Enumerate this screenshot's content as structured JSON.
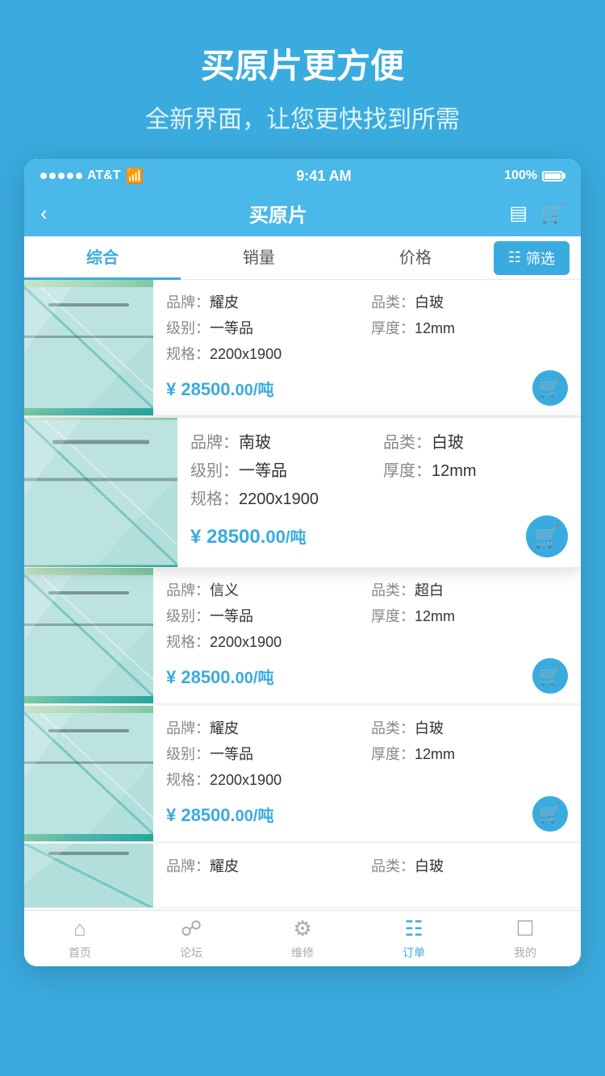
{
  "promo": {
    "title": "买原片更方便",
    "subtitle": "全新界面，让您更快找到所需"
  },
  "statusBar": {
    "carrier": "AT&T",
    "time": "9:41 AM",
    "battery": "100%"
  },
  "navBar": {
    "title": "买原片"
  },
  "sortBar": {
    "tabs": [
      "综合",
      "销量",
      "价格"
    ],
    "activeTab": "综合",
    "filterLabel": "筛选"
  },
  "products": [
    {
      "brand_label": "品牌：",
      "brand": "耀皮",
      "category_label": "品类：",
      "category": "白玻",
      "grade_label": "级别：",
      "grade": "一等品",
      "thickness_label": "厚度：",
      "thickness": "12mm",
      "spec_label": "规格：",
      "spec": "2200x1900",
      "price": "¥ 28500.",
      "price_decimal": "00",
      "price_unit": "/吨",
      "highlighted": false
    },
    {
      "brand_label": "品牌：",
      "brand": "南玻",
      "category_label": "品类：",
      "category": "白玻",
      "grade_label": "级别：",
      "grade": "一等品",
      "thickness_label": "厚度：",
      "thickness": "12mm",
      "spec_label": "规格：",
      "spec": "2200x1900",
      "price": "¥ 28500.",
      "price_decimal": "00",
      "price_unit": "/吨",
      "highlighted": true
    },
    {
      "brand_label": "品牌：",
      "brand": "信义",
      "category_label": "品类：",
      "category": "超白",
      "grade_label": "级别：",
      "grade": "一等品",
      "thickness_label": "厚度：",
      "thickness": "12mm",
      "spec_label": "规格：",
      "spec": "2200x1900",
      "price": "¥ 28500.",
      "price_decimal": "00",
      "price_unit": "/吨",
      "highlighted": false
    },
    {
      "brand_label": "品牌：",
      "brand": "耀皮",
      "category_label": "品类：",
      "category": "白玻",
      "grade_label": "级别：",
      "grade": "一等品",
      "thickness_label": "厚度：",
      "thickness": "12mm",
      "spec_label": "规格：",
      "spec": "2200x1900",
      "price": "¥ 28500.",
      "price_decimal": "00",
      "price_unit": "/吨",
      "highlighted": false
    },
    {
      "brand_label": "品牌：",
      "brand": "耀皮",
      "category_label": "品类：",
      "category": "白玻",
      "grade_label": "级别：",
      "grade": "",
      "thickness_label": "",
      "thickness": "",
      "spec_label": "",
      "spec": "",
      "price": "",
      "price_decimal": "",
      "price_unit": "",
      "highlighted": false,
      "partial": true
    }
  ],
  "tabBar": {
    "tabs": [
      {
        "id": "home",
        "label": "首页",
        "active": false
      },
      {
        "id": "forum",
        "label": "论坛",
        "active": false
      },
      {
        "id": "repair",
        "label": "维修",
        "active": false
      },
      {
        "id": "orders",
        "label": "订单",
        "active": true
      },
      {
        "id": "mine",
        "label": "我的",
        "active": false
      }
    ]
  }
}
